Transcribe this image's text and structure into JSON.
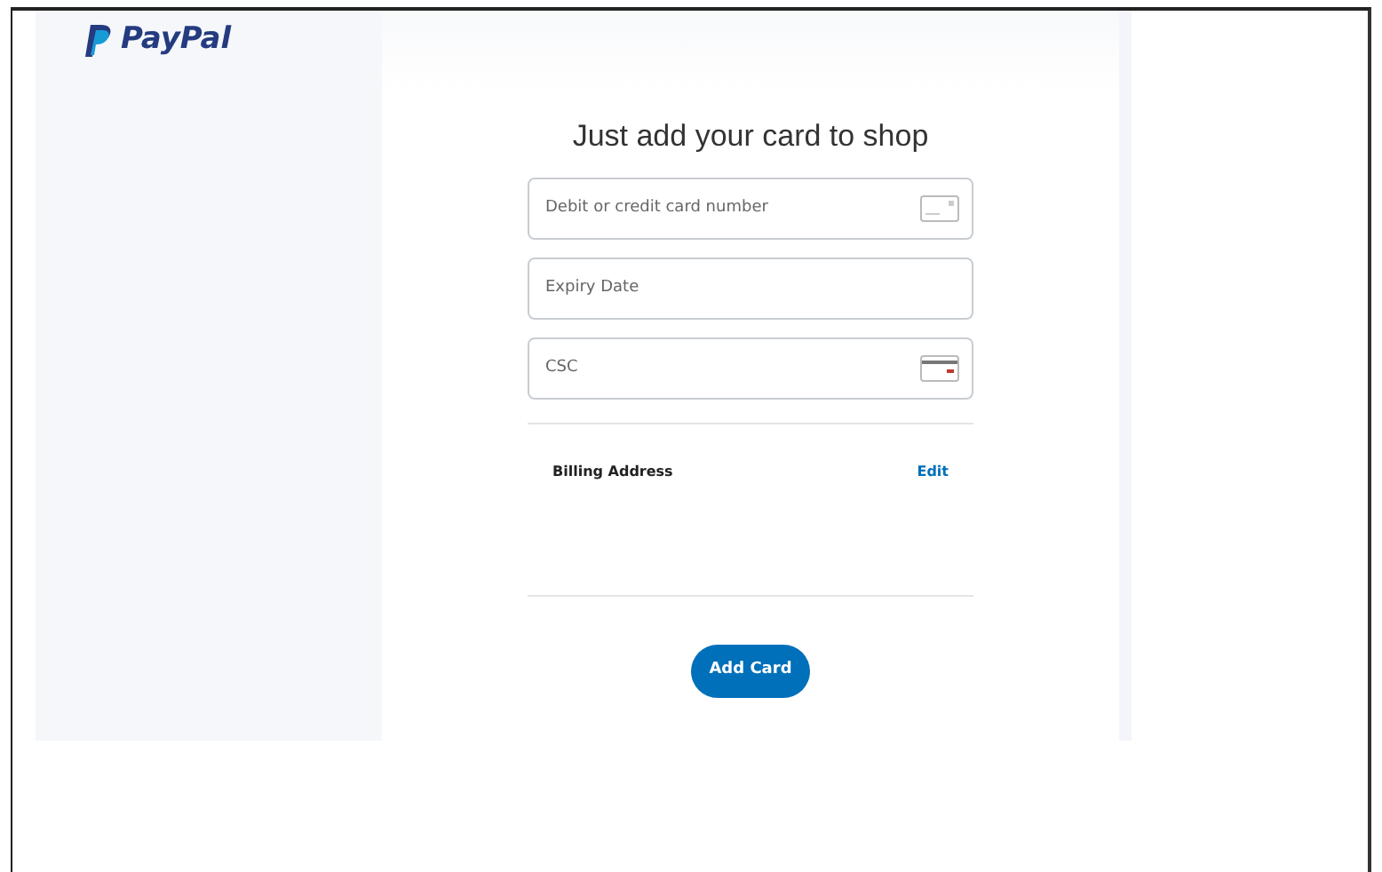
{
  "logo": {
    "text": "PayPal"
  },
  "heading": "Just add your card to shop",
  "fields": [
    {
      "placeholder": "Debit or credit card number",
      "kind": "card"
    },
    {
      "placeholder": "Expiry Date",
      "kind": "plain"
    },
    {
      "placeholder": "CSC",
      "kind": "csc"
    }
  ],
  "billing": {
    "label": "Billing Address",
    "action": "Edit"
  },
  "button": "Add Card"
}
